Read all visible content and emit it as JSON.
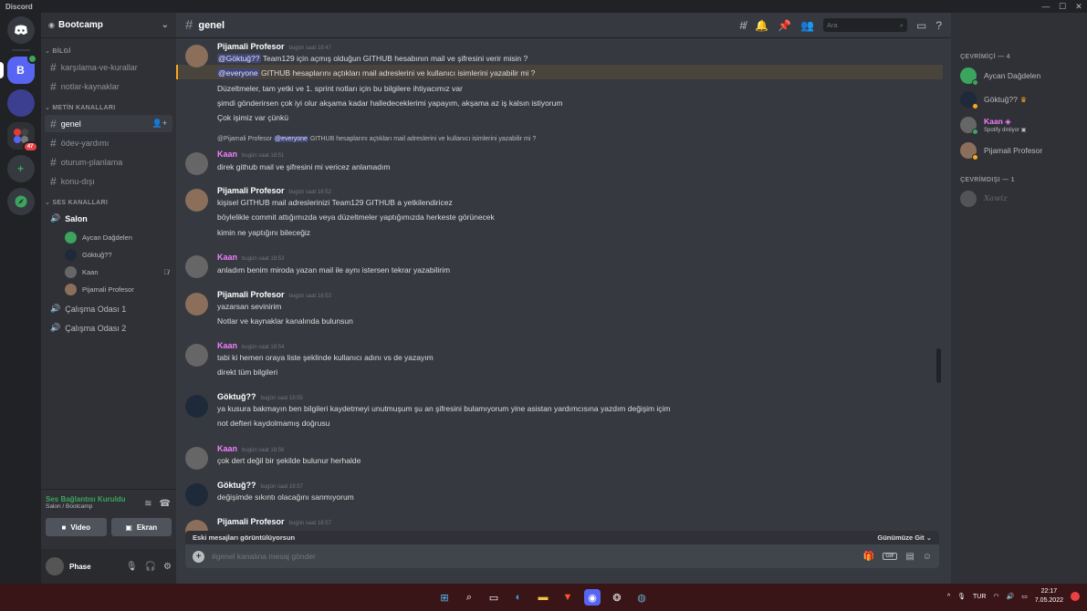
{
  "window": {
    "title": "Discord",
    "controls": [
      "—",
      "☐",
      "✕"
    ]
  },
  "guilds": [
    {
      "label": "",
      "kind": "home"
    },
    {
      "label": "B",
      "kind": "selected",
      "voice": true
    },
    {
      "label": "",
      "kind": "dark"
    },
    {
      "label": "",
      "kind": "folder",
      "badge": "47"
    },
    {
      "label": "+",
      "kind": "add"
    },
    {
      "label": "",
      "kind": "explore"
    }
  ],
  "server": {
    "name": "Bootcamp"
  },
  "categories": {
    "info": "BİLGİ",
    "text": "METİN KANALLARI",
    "voice": "SES KANALLARI"
  },
  "info_channels": [
    "karşılama-ve-kurallar",
    "notlar-kaynaklar"
  ],
  "text_channels": [
    "genel",
    "ödev-yardımı",
    "oturum-planlama",
    "konu-dışı"
  ],
  "voice_channels": {
    "salon": "Salon",
    "salon_users": [
      "Aycan Dağdelen",
      "Göktuğ??",
      "Kaan",
      "Pijamali Profesor"
    ],
    "others": [
      "Çalışma Odası 1",
      "Çalışma Odası 2"
    ]
  },
  "voice_panel": {
    "status": "Ses Bağlantısı Kuruldu",
    "location": "Salon / Bootcamp",
    "video": "Video",
    "screen": "Ekran"
  },
  "user": {
    "name": "Phase"
  },
  "channel": {
    "name": "genel"
  },
  "search": {
    "placeholder": "Ara"
  },
  "messages": {
    "m1": {
      "author": "Pijamali Profesor",
      "time": "bugün saat 18:47",
      "l1_mention": "@Göktuğ??",
      "l1": "Team129 için açmış olduğun GITHUB hesabının mail ve şifresini verir misin ?",
      "l2_mention": "@everyone",
      "l2": "GITHUB hesaplarını açtıkları mail adreslerini ve kullanıcı isimlerini yazabilir mi ?",
      "l3": "Düzeltmeler, tam yetki ve 1. sprint notları için bu bilgilere ihtiyacımız var",
      "l4": "şimdi gönderirsen çok iyi olur akşama kadar halledeceklerimi yapayım, akşama az iş kalsın istiyorum",
      "l5": "Çok işimiz var çünkü"
    },
    "reply": {
      "author": "@Pijamali Profesor",
      "mention": "@everyone",
      "text": "GITHUB hesaplarını açtıkları mail adreslerini ve kullanıcı isimlerini yazabilir mi ?"
    },
    "m2": {
      "author": "Kaan",
      "time": "bugün saat 18:51",
      "l1": "direk github mail ve şifresini mi vericez anlamadım"
    },
    "m3": {
      "author": "Pijamali Profesor",
      "time": "bugün saat 18:52",
      "l1": "kişisel GITHUB mail adreslerinizi Team129 GITHUB a yetkilendiricez",
      "l2": "böylelikle commit attığımızda veya düzeltmeler yaptığımızda herkeste görünecek",
      "l3": "kimin ne yaptığını bileceğiz"
    },
    "m4": {
      "author": "Kaan",
      "time": "bugün saat 18:53",
      "l1": "anladım benim miroda yazan mail ile aynı istersen tekrar yazabilirim"
    },
    "m5": {
      "author": "Pijamali Profesor",
      "time": "bugün saat 18:53",
      "l1": "yazarsan sevinirim",
      "l2": "Notlar ve kaynaklar kanalında bulunsun"
    },
    "m6": {
      "author": "Kaan",
      "time": "bugün saat 18:54",
      "l1": "tabi ki hemen oraya liste şeklinde kullanıcı adını vs de yazayım",
      "l2": "direkt tüm bilgileri"
    },
    "m7": {
      "author": "Göktuğ??",
      "time": "bugün saat 18:55",
      "l1": "ya kusura bakmayın ben bilgileri kaydetmeyi unutmuşum şu an şifresini bulamıyorum yine asistan yardımcısına yazdım değişim içim",
      "l2": "not defteri kaydolmamış doğrusu"
    },
    "m8": {
      "author": "Kaan",
      "time": "bugün saat 18:56",
      "l1": "çok dert değil bir şekilde bulunur herhalde"
    },
    "m9": {
      "author": "Göktuğ??",
      "time": "bugün saat 18:57",
      "l1": "değişimde sıkıntı olacağını sanmıyorum"
    },
    "m10": {
      "author": "Pijamali Profesor",
      "time": "bugün saat 18:57"
    }
  },
  "older_bar": {
    "text": "Eski mesajları görüntülüyorsun",
    "jump": "Günümüze Git"
  },
  "composer": {
    "placeholder": "#genel kanalına mesaj gönder",
    "gif": "GIF"
  },
  "members": {
    "online_header": "ÇEVRİMİÇİ — 4",
    "online": [
      {
        "name": "Aycan Dağdelen",
        "activity": ""
      },
      {
        "name": "Göktuğ??",
        "activity": ""
      },
      {
        "name": "Kaan",
        "activity": "Spotify dinliyor"
      },
      {
        "name": "Pijamali Profesor",
        "activity": ""
      }
    ],
    "offline_header": "ÇEVRİMDIŞI — 1",
    "offline": [
      {
        "name": "Xawiz"
      }
    ]
  },
  "taskbar": {
    "lang": "TUR",
    "time": "22:17",
    "date": "7.05.2022"
  },
  "colors": {
    "accent": "#5865f2",
    "online": "#3ba55d",
    "kaan": "#f47fff",
    "mention_bg": "#414675",
    "highlight": "#faa81a"
  }
}
